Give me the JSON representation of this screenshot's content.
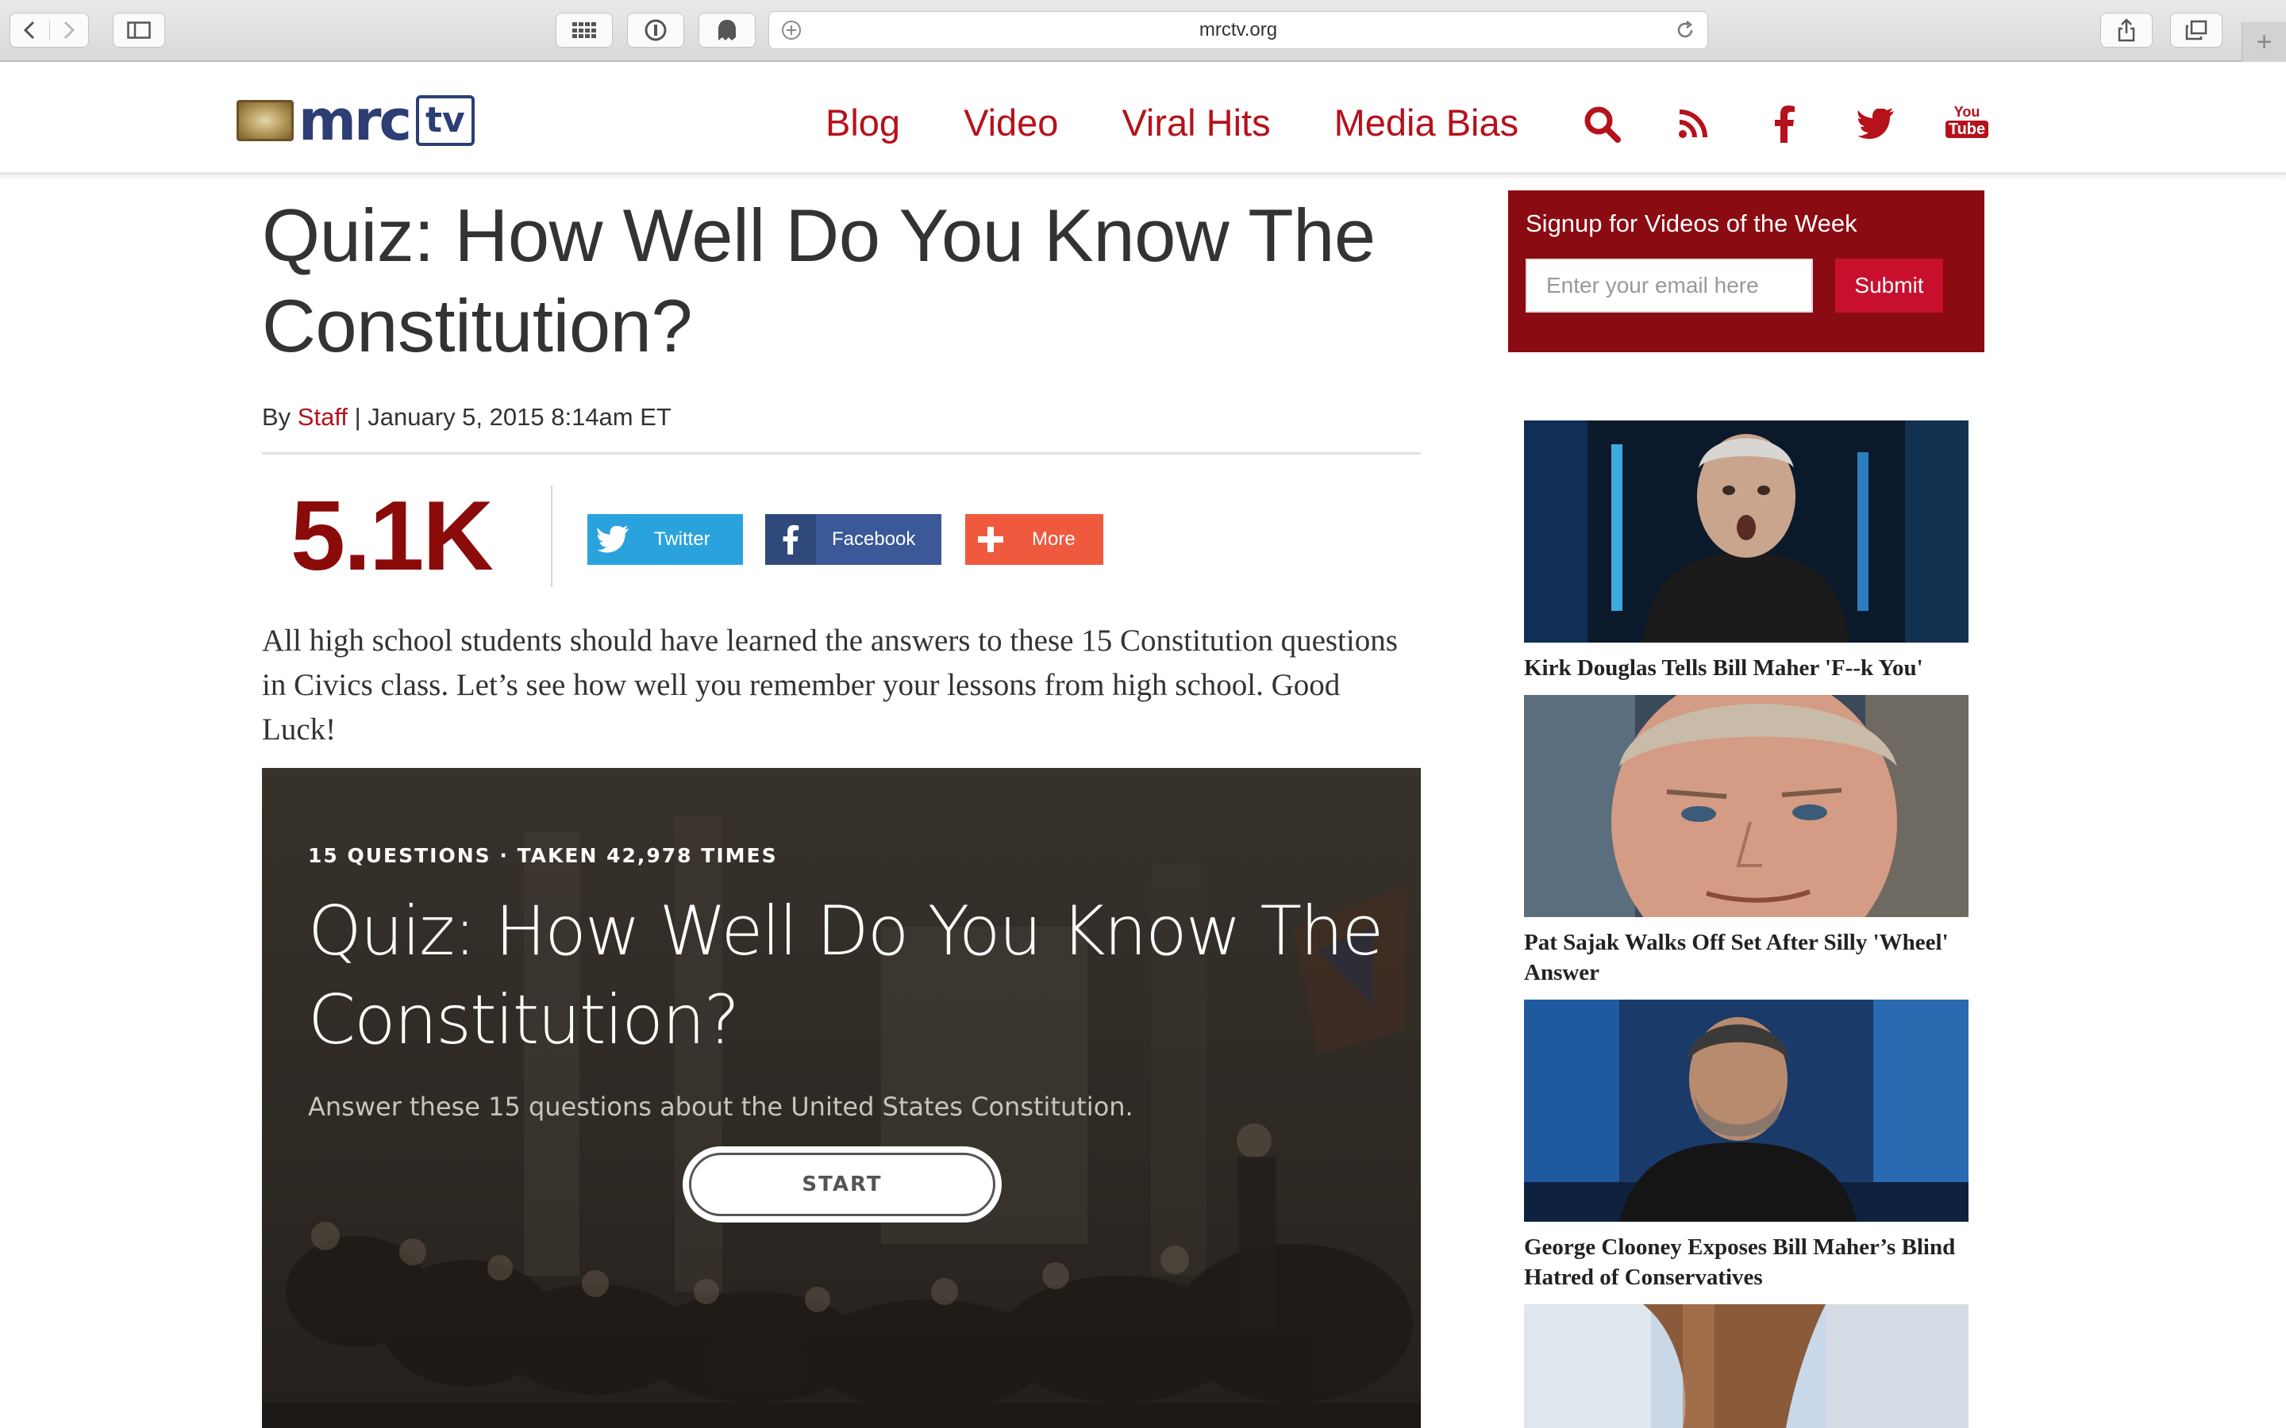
{
  "browser": {
    "url": "mrctv.org"
  },
  "header": {
    "logo_text": "mrc",
    "logo_tv": "tv",
    "nav": [
      "Blog",
      "Video",
      "Viral Hits",
      "Media Bias"
    ],
    "icons": [
      "search-icon",
      "rss-icon",
      "facebook-icon",
      "twitter-icon",
      "youtube-icon"
    ],
    "youtube_top": "You",
    "youtube_bottom": "Tube"
  },
  "article": {
    "title": "Quiz: How Well Do You Know The Constitution?",
    "byline_prefix": "By ",
    "author": "Staff",
    "byline_date": " | January 5, 2015 8:14am ET",
    "share_count": "5.1K",
    "share_buttons": [
      "Twitter",
      "Facebook",
      "More"
    ],
    "intro": "All high school students should have learned the answers to these 15 Constitution questions in Civics class. Let’s see how well you remember your lessons from high school. Good Luck!"
  },
  "quiz": {
    "meta": "15 QUESTIONS · TAKEN 42,978 TIMES",
    "title": "Quiz: How Well Do You Know The Constitution?",
    "description": "Answer these 15 questions about the United States Constitution.",
    "start_label": "START"
  },
  "sidebar": {
    "signup_title": "Signup for Videos of the Week",
    "email_placeholder": "Enter your email here",
    "submit_label": "Submit",
    "videos": [
      "Kirk Douglas Tells Bill Maher 'F--k You'",
      "Pat Sajak Walks Off Set After Silly 'Wheel' Answer",
      "George Clooney Exposes Bill Maher’s Blind Hatred of Conservatives"
    ]
  },
  "colors": {
    "brand_red": "#b5121b",
    "share_red": "#8b0b0b",
    "signup_bg": "#8b0b12",
    "twitter": "#2aa3dd",
    "facebook": "#3b5998",
    "more": "#ef5a3f",
    "logo_blue": "#2c3e73"
  }
}
